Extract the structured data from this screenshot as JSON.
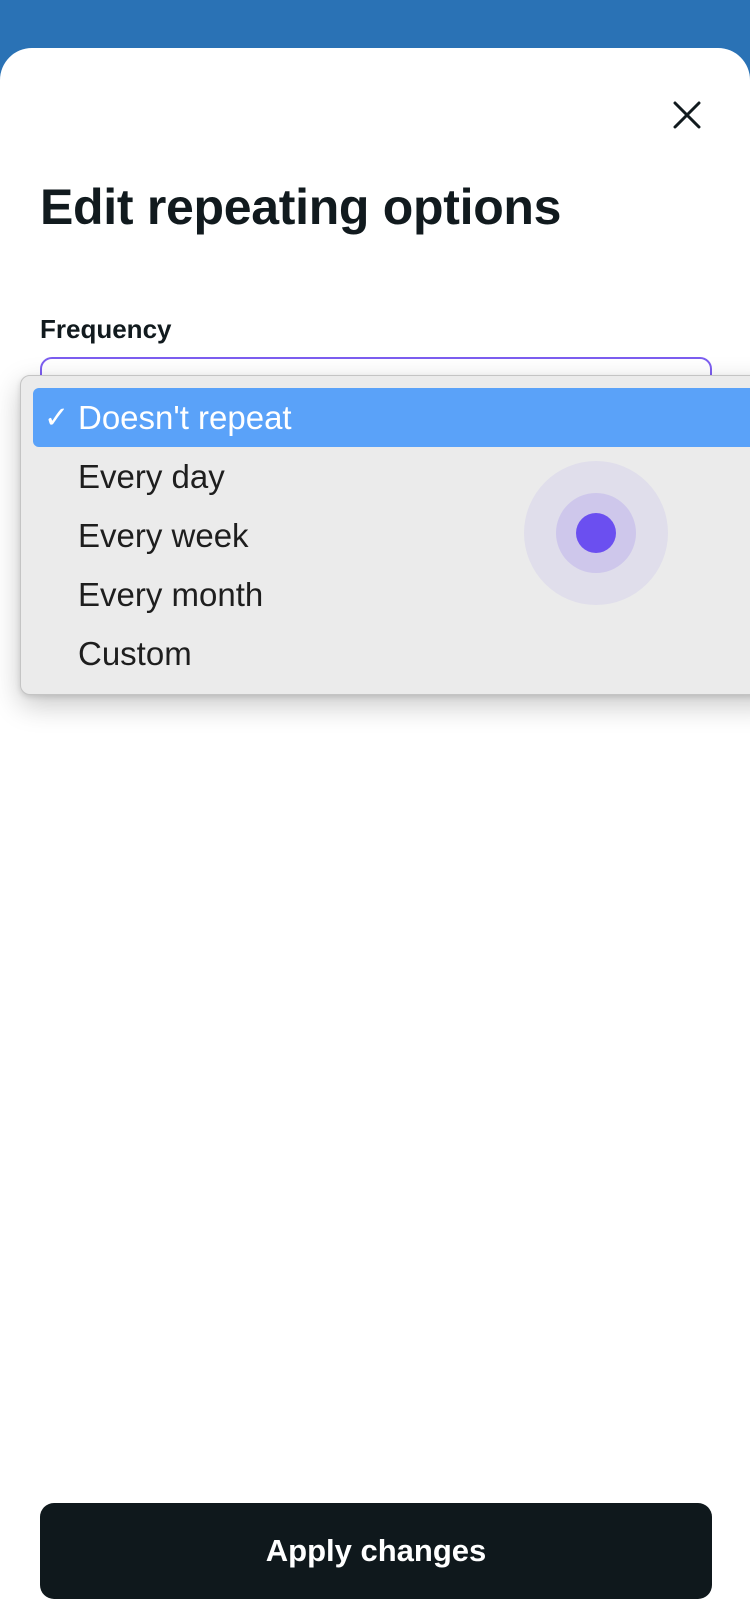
{
  "modal": {
    "title": "Edit repeating options",
    "close_icon": "close-icon"
  },
  "frequency": {
    "label": "Frequency",
    "selected": "Doesn't repeat",
    "options": [
      {
        "label": "Doesn't repeat",
        "selected": true
      },
      {
        "label": "Every day",
        "selected": false
      },
      {
        "label": "Every week",
        "selected": false
      },
      {
        "label": "Every month",
        "selected": false
      },
      {
        "label": "Custom",
        "selected": false
      }
    ],
    "check_glyph": "✓"
  },
  "footer": {
    "apply_label": "Apply changes"
  },
  "colors": {
    "header_bg": "#2a72b5",
    "accent": "#7c5ef0",
    "selected_option_bg": "#5aa2f9",
    "primary_button_bg": "#0f181c",
    "touch_indicator": "#6b4ff0"
  }
}
